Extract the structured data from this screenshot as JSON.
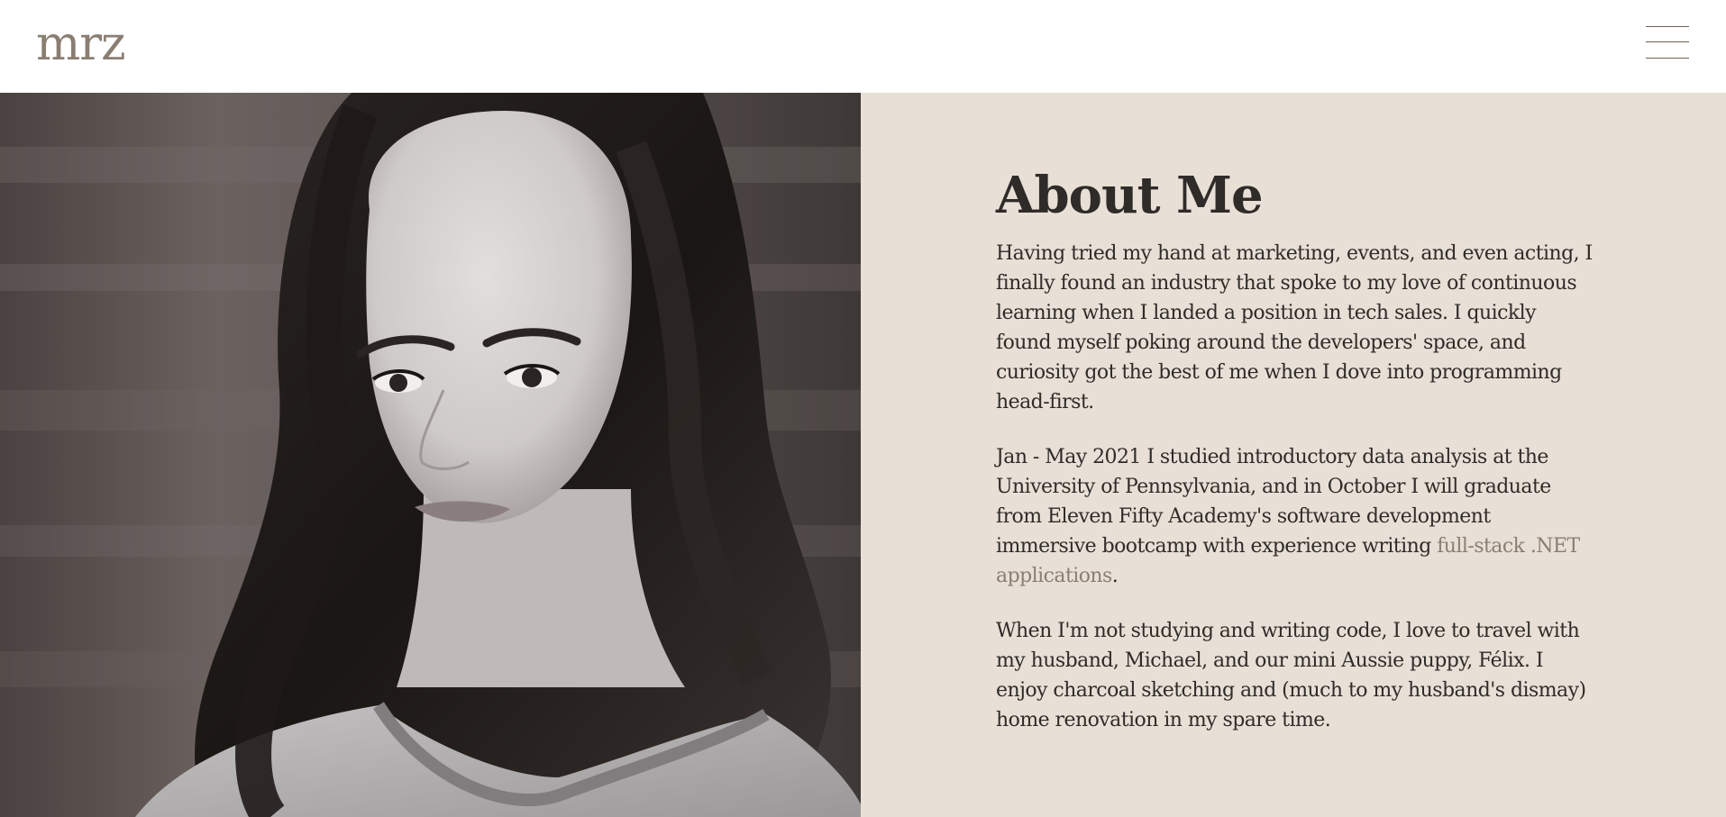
{
  "header": {
    "logo": "mrz",
    "menu_icon": "hamburger-menu-icon"
  },
  "photo": {
    "description_icon": "portrait-photo"
  },
  "about": {
    "title": "About Me",
    "paragraph1": "Having tried my hand at marketing, events, and even acting, I finally found an industry that spoke to my love of continuous learning when I landed a position in tech sales. I quickly found myself poking around the developers' space, and curiosity got the best of me when I dove into programming head-first.",
    "paragraph2_before": "Jan - May 2021 I studied introductory data analysis at the University of Pennsylvania, and in October I will graduate from Eleven Fifty Academy's software development immersive bootcamp with experience writing ",
    "paragraph2_link": "full-stack .NET applications",
    "paragraph2_after": ".",
    "paragraph3": "When I'm not studying and writing code, I love to travel with my husband, Michael, and our mini Aussie puppy, Félix. I enjoy charcoal sketching and (much to my husband's dismay) home renovation in my spare time."
  },
  "colors": {
    "logo": "#8a7e72",
    "about_background": "#e8e0d6",
    "text": "#2f2b28",
    "link": "#8a7e72"
  }
}
